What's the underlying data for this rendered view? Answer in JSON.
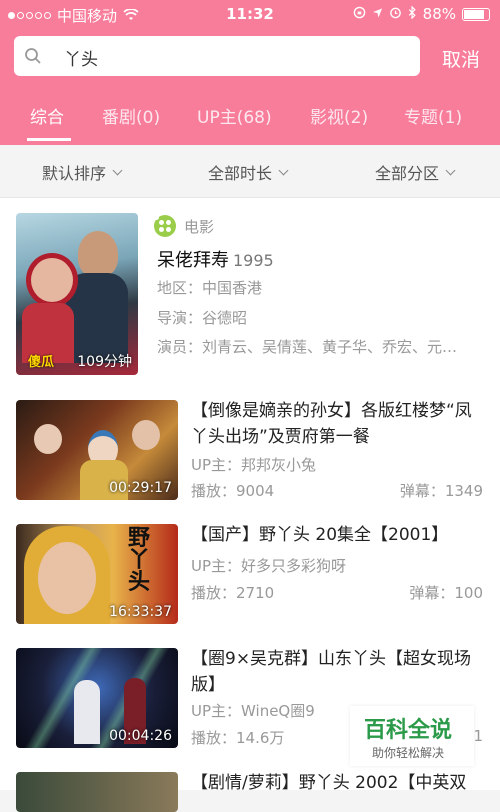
{
  "status_bar": {
    "carrier": "中国移动",
    "time": "11:32",
    "battery": "88%"
  },
  "search": {
    "query": "丫头",
    "cancel_label": "取消"
  },
  "tabs": [
    {
      "label": "综合"
    },
    {
      "label": "番剧(0)"
    },
    {
      "label": "UP主(68)"
    },
    {
      "label": "影视(2)"
    },
    {
      "label": "专题(1)"
    }
  ],
  "filters": {
    "sort": "默认排序",
    "duration": "全部时长",
    "partition": "全部分区"
  },
  "movie": {
    "category": "电影",
    "title": "呆佬拜寿",
    "year": "1995",
    "region": "地区：中国香港",
    "director": "导演：谷德昭",
    "cast": "演员：刘青云、吴倩莲、黄子华、乔宏、元…",
    "duration": "109分钟",
    "poster_text": "傻瓜"
  },
  "videos": [
    {
      "title": "【倒像是嫡亲的孙女】各版红楼梦“凤丫头出场”及贾府第一餐",
      "uploader": "UP主：邦邦灰小兔",
      "plays": "播放：9004",
      "danmaku": "弹幕：1349",
      "duration": "00:29:17"
    },
    {
      "title": "【国产】野丫头 20集全【2001】",
      "uploader": "UP主：好多只多彩狗呀",
      "plays": "播放：2710",
      "danmaku": "弹幕：100",
      "duration": "16:33:37",
      "thumb_text": "野丫头"
    },
    {
      "title": "【圈9×吴克群】山东丫头【超女现场版】",
      "uploader": "UP主：WineQ圈9",
      "plays": "播放：14.6万",
      "danmaku": "1",
      "duration": "00:04:26"
    },
    {
      "title": "【剧情/萝莉】野丫头 2002【中英双"
    }
  ],
  "watermark": {
    "title": "百科全说",
    "subtitle": "助你轻松解决"
  }
}
